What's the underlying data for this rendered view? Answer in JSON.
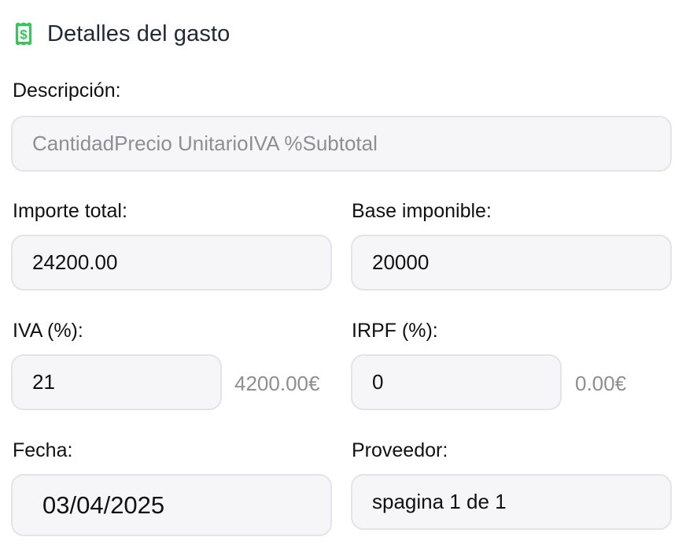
{
  "section": {
    "title": "Detalles del gasto",
    "icon": "receipt-dollar-icon",
    "icon_color": "#34c759"
  },
  "descripcion": {
    "label": "Descripción:",
    "placeholder": "CantidadPrecio UnitarioIVA %Subtotal",
    "value": ""
  },
  "importe_total": {
    "label": "Importe total:",
    "value": "24200.00"
  },
  "base_imponible": {
    "label": "Base imponible:",
    "value": "20000"
  },
  "iva": {
    "label": "IVA (%):",
    "value": "21",
    "amount": "4200.00€"
  },
  "irpf": {
    "label": "IRPF (%):",
    "value": "0",
    "amount": "0.00€"
  },
  "fecha": {
    "label": "Fecha:",
    "value": "03/04/2025"
  },
  "proveedor": {
    "label": "Proveedor:",
    "value": "spagina 1 de 1"
  }
}
